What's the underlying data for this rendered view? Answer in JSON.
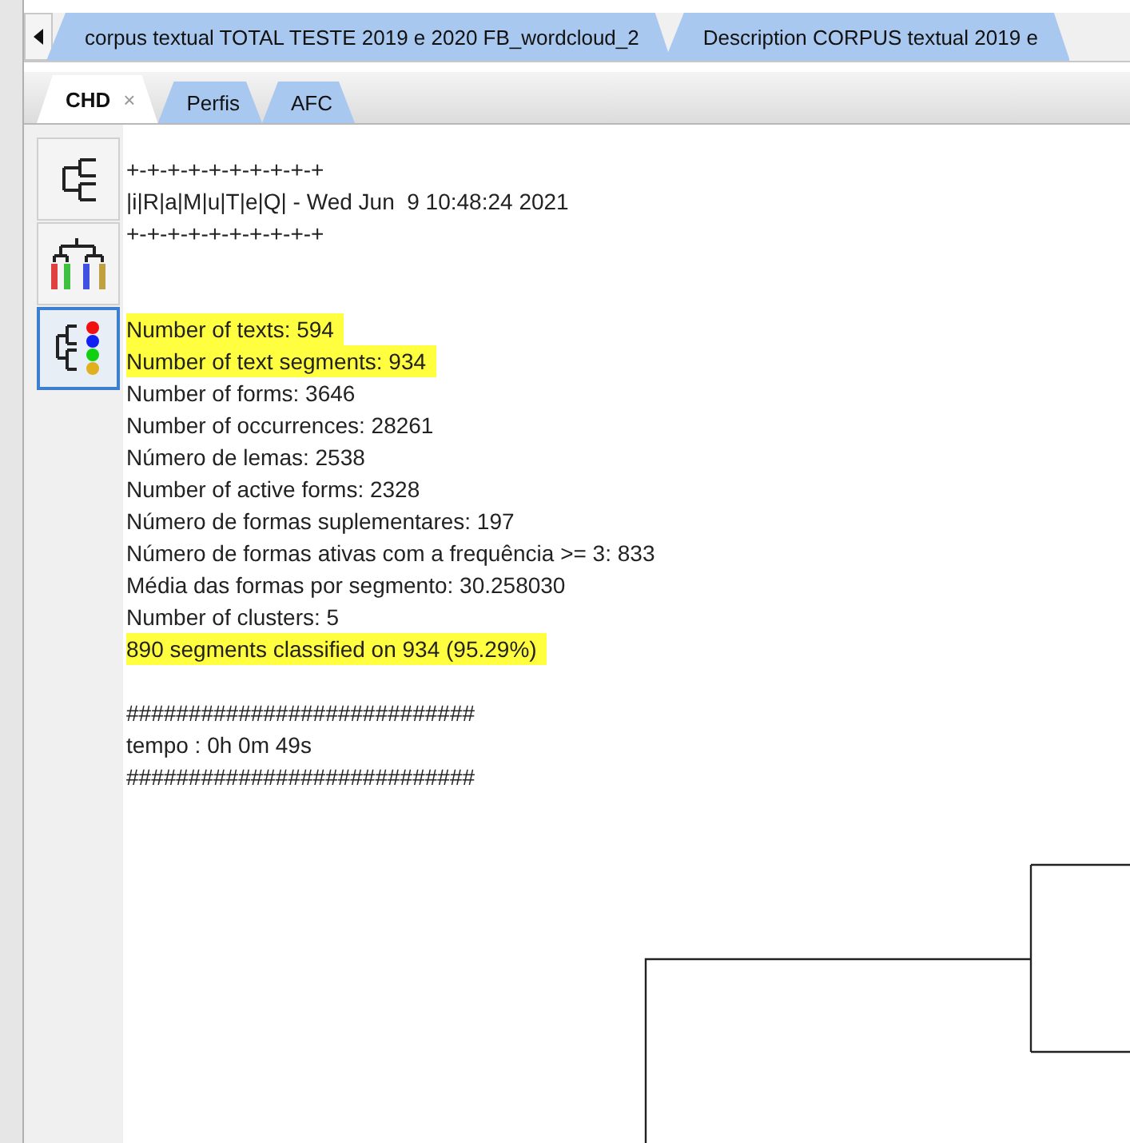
{
  "document_tabs": [
    {
      "label": "corpus textual TOTAL TESTE 2019 e 2020 FB_wordcloud_2"
    },
    {
      "label": "Description CORPUS textual 2019 e"
    }
  ],
  "result_tabs": [
    {
      "label": "CHD",
      "selected": true,
      "close": "×"
    },
    {
      "label": "Perfis",
      "selected": false
    },
    {
      "label": "AFC",
      "selected": false
    }
  ],
  "sidebar": [
    {
      "kind": "tree",
      "selected": false
    },
    {
      "kind": "dendrogram",
      "selected": false
    },
    {
      "kind": "clusters",
      "selected": true
    }
  ],
  "report_lines": [
    {
      "kind": "text",
      "text": "+-+-+-+-+-+-+-+-+-+",
      "highlighted": false
    },
    {
      "kind": "text",
      "text": "|i|R|a|M|u|T|e|Q| - Wed Jun  9 10:48:24 2021",
      "highlighted": false
    },
    {
      "kind": "text",
      "text": "+-+-+-+-+-+-+-+-+-+",
      "highlighted": false
    },
    {
      "kind": "blank"
    },
    {
      "kind": "blank"
    },
    {
      "kind": "text",
      "text": "Number of texts: 594",
      "highlighted": true
    },
    {
      "kind": "text",
      "text": "Number of text segments: 934",
      "highlighted": true
    },
    {
      "kind": "text",
      "text": "Number of forms: 3646",
      "highlighted": false
    },
    {
      "kind": "text",
      "text": "Number of occurrences: 28261",
      "highlighted": false
    },
    {
      "kind": "text",
      "text": "Número de lemas: 2538",
      "highlighted": false
    },
    {
      "kind": "text",
      "text": "Number of active forms: 2328",
      "highlighted": false
    },
    {
      "kind": "text",
      "text": "Número de formas suplementares: 197",
      "highlighted": false
    },
    {
      "kind": "text",
      "text": "Número de formas ativas com a frequência >= 3: 833",
      "highlighted": false
    },
    {
      "kind": "text",
      "text": "Média das formas por segmento: 30.258030",
      "highlighted": false
    },
    {
      "kind": "text",
      "text": "Number of clusters: 5",
      "highlighted": false
    },
    {
      "kind": "text",
      "text": "890 segments classified on 934 (95.29%)",
      "highlighted": true
    },
    {
      "kind": "blank"
    },
    {
      "kind": "text",
      "text": "############################",
      "highlighted": false
    },
    {
      "kind": "text",
      "text": "tempo : 0h 0m 49s",
      "highlighted": false
    },
    {
      "kind": "text",
      "text": "############################",
      "highlighted": false
    }
  ]
}
